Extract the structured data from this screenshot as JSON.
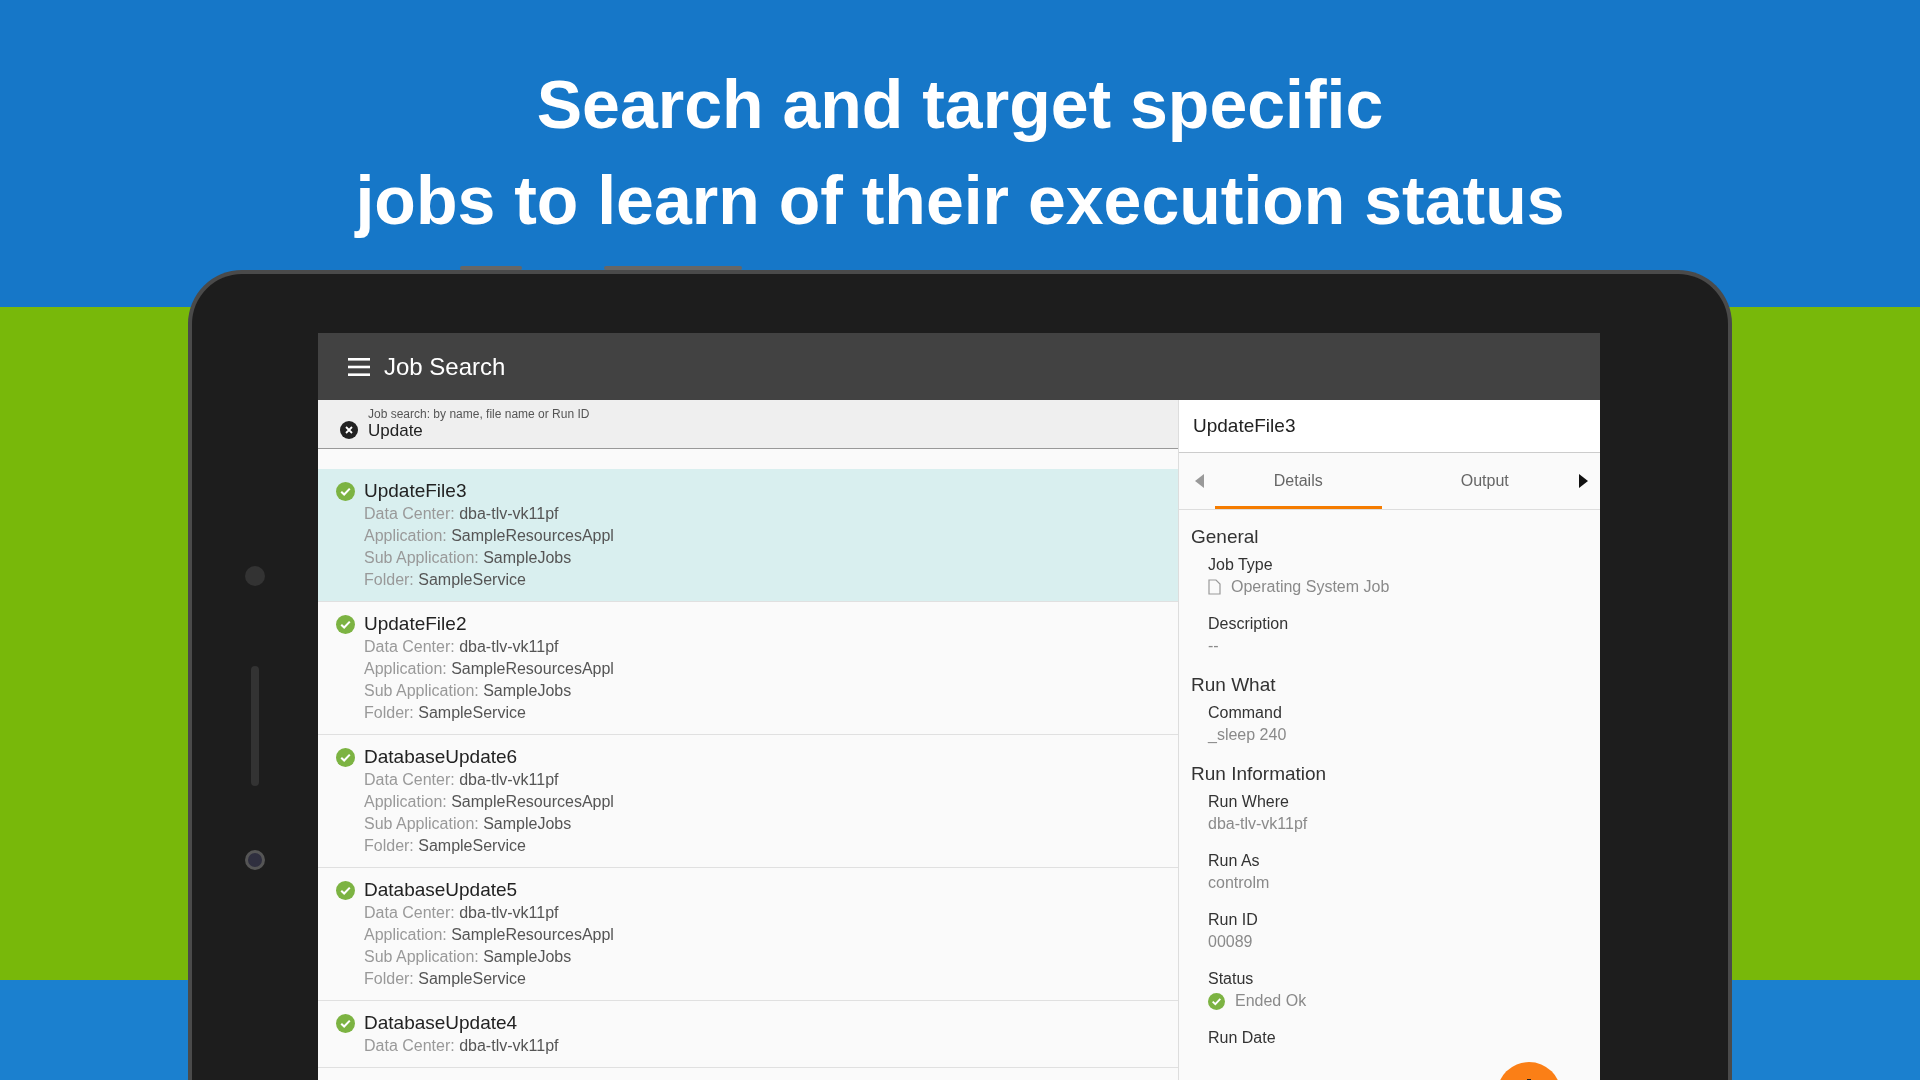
{
  "headline": [
    "Search and target specific",
    "jobs to learn of their execution status"
  ],
  "app_bar": {
    "title": "Job Search"
  },
  "search": {
    "label": "Job search: by name, file name or Run ID",
    "value": "Update"
  },
  "jobs": [
    {
      "name": "UpdateFile3",
      "selected": true,
      "fields": [
        {
          "label": "Data Center:",
          "value": "dba-tlv-vk11pf"
        },
        {
          "label": "Application:",
          "value": "SampleResourcesAppl"
        },
        {
          "label": "Sub Application:",
          "value": "SampleJobs"
        },
        {
          "label": "Folder:",
          "value": "SampleService"
        }
      ]
    },
    {
      "name": "UpdateFile2",
      "selected": false,
      "fields": [
        {
          "label": "Data Center:",
          "value": "dba-tlv-vk11pf"
        },
        {
          "label": "Application:",
          "value": "SampleResourcesAppl"
        },
        {
          "label": "Sub Application:",
          "value": "SampleJobs"
        },
        {
          "label": "Folder:",
          "value": "SampleService"
        }
      ]
    },
    {
      "name": "DatabaseUpdate6",
      "selected": false,
      "fields": [
        {
          "label": "Data Center:",
          "value": "dba-tlv-vk11pf"
        },
        {
          "label": "Application:",
          "value": "SampleResourcesAppl"
        },
        {
          "label": "Sub Application:",
          "value": "SampleJobs"
        },
        {
          "label": "Folder:",
          "value": "SampleService"
        }
      ]
    },
    {
      "name": "DatabaseUpdate5",
      "selected": false,
      "fields": [
        {
          "label": "Data Center:",
          "value": "dba-tlv-vk11pf"
        },
        {
          "label": "Application:",
          "value": "SampleResourcesAppl"
        },
        {
          "label": "Sub Application:",
          "value": "SampleJobs"
        },
        {
          "label": "Folder:",
          "value": "SampleService"
        }
      ]
    },
    {
      "name": "DatabaseUpdate4",
      "selected": false,
      "fields": [
        {
          "label": "Data Center:",
          "value": "dba-tlv-vk11pf"
        }
      ]
    }
  ],
  "detail": {
    "title": "UpdateFile3",
    "tabs": [
      {
        "label": "Details",
        "selected": true
      },
      {
        "label": "Output",
        "selected": false
      }
    ],
    "sections": [
      {
        "heading": "General",
        "fields": [
          {
            "label": "Job Type",
            "value": "Operating System Job",
            "kind": "job-type"
          },
          {
            "label": "Description",
            "value": "--"
          }
        ]
      },
      {
        "heading": "Run What",
        "fields": [
          {
            "label": "Command",
            "value": "_sleep 240"
          }
        ]
      },
      {
        "heading": "Run Information",
        "fields": [
          {
            "label": "Run Where",
            "value": "dba-tlv-vk11pf"
          },
          {
            "label": "Run As",
            "value": "controlm"
          },
          {
            "label": "Run ID",
            "value": "00089"
          },
          {
            "label": "Status",
            "value": "Ended Ok",
            "kind": "status"
          },
          {
            "label": "Run Date"
          }
        ]
      }
    ]
  }
}
